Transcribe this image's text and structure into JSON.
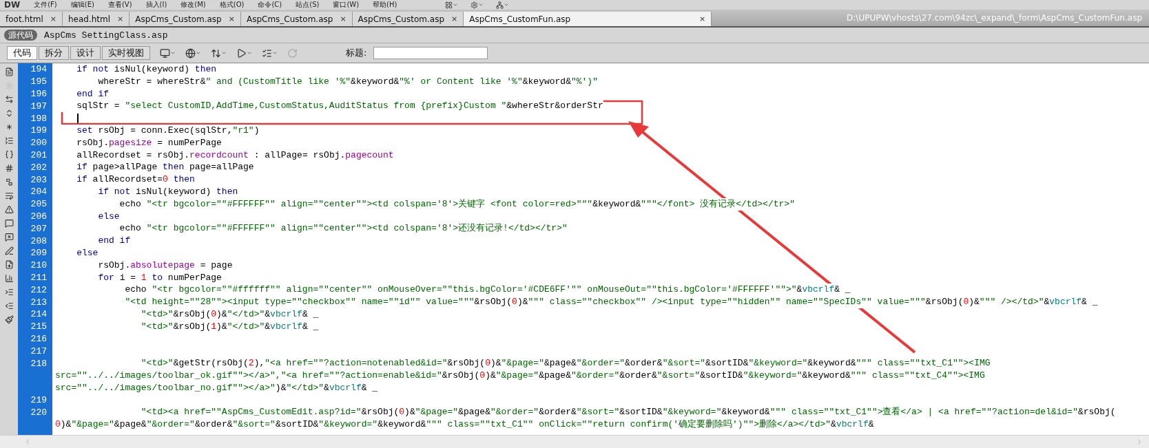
{
  "menu_bar": {
    "logo": "DW",
    "items": [
      "文件(F)",
      "编辑(E)",
      "查看(V)",
      "插入(I)",
      "修改(M)",
      "格式(O)",
      "命令(C)",
      "站点(S)",
      "窗口(W)",
      "帮助(H)"
    ]
  },
  "tabs": [
    {
      "label": "foot.html",
      "close": "×",
      "selected": false
    },
    {
      "label": "head.html",
      "close": "×",
      "selected": false
    },
    {
      "label": "AspCms_Custom.asp",
      "close": "×",
      "selected": false
    },
    {
      "label": "AspCms_Custom.asp",
      "close": "×",
      "selected": false
    },
    {
      "label": "AspCms_Custom.asp",
      "close": "×",
      "selected": false
    },
    {
      "label": "AspCms_CustomFun.asp",
      "close": "×",
      "selected": true
    }
  ],
  "file_path": "D:\\UPUPW\\vhosts\\27.com\\94zc\\_expand\\_form\\AspCms_CustomFun.asp",
  "related_files": {
    "source_label": "源代码",
    "files": [
      "AspCms SettingClass.asp"
    ]
  },
  "view_buttons": [
    {
      "label": "代码",
      "selected": true
    },
    {
      "label": "拆分",
      "selected": false
    },
    {
      "label": "设计",
      "selected": false
    },
    {
      "label": "实时视图",
      "selected": false
    }
  ],
  "title_field": {
    "label": "标题:"
  },
  "code_lines": [
    {
      "number": "194",
      "segments": [
        {
          "kind": "kw",
          "text": "    if not"
        },
        {
          "kind": "plain",
          "text": " isNul(keyword) "
        },
        {
          "kind": "kw",
          "text": "then"
        }
      ]
    },
    {
      "number": "195",
      "segments": [
        {
          "kind": "plain",
          "text": "        whereStr = whereStr&"
        },
        {
          "kind": "str",
          "text": "\" and (CustomTitle like '%\""
        },
        {
          "kind": "plain",
          "text": "&keyword&"
        },
        {
          "kind": "str",
          "text": "\"%' or Content like '%\""
        },
        {
          "kind": "plain",
          "text": "&keyword&"
        },
        {
          "kind": "str",
          "text": "\"%')\""
        }
      ]
    },
    {
      "number": "196",
      "segments": [
        {
          "kind": "kw",
          "text": "    end if"
        }
      ]
    },
    {
      "number": "197",
      "segments": [
        {
          "kind": "plain",
          "text": "    sqlStr = "
        },
        {
          "kind": "str",
          "text": "\"select CustomID,AddTime,CustomStatus,AuditStatus from {prefix}Custom \""
        },
        {
          "kind": "plain",
          "text": "&whereStr&orderStr"
        }
      ]
    },
    {
      "number": "198",
      "cursor": true
    },
    {
      "number": "199",
      "segments": [
        {
          "kind": "kw",
          "text": "    set"
        },
        {
          "kind": "plain",
          "text": " rsObj = conn.Exec(sqlStr,"
        },
        {
          "kind": "str",
          "text": "\"r1\""
        },
        {
          "kind": "plain",
          "text": ")"
        }
      ]
    },
    {
      "number": "200",
      "segments": [
        {
          "kind": "plain",
          "text": "    rsObj."
        },
        {
          "kind": "prop",
          "text": "pagesize"
        },
        {
          "kind": "plain",
          "text": " = numPerPage"
        }
      ]
    },
    {
      "number": "201",
      "segments": [
        {
          "kind": "plain",
          "text": "    allRecordset = rsObj."
        },
        {
          "kind": "prop",
          "text": "recordcount"
        },
        {
          "kind": "plain",
          "text": " : allPage= rsObj."
        },
        {
          "kind": "prop",
          "text": "pagecount"
        }
      ]
    },
    {
      "number": "202",
      "segments": [
        {
          "kind": "kw",
          "text": "    if"
        },
        {
          "kind": "plain",
          "text": " page>allPage "
        },
        {
          "kind": "kw",
          "text": "then"
        },
        {
          "kind": "plain",
          "text": " page=allPage"
        }
      ]
    },
    {
      "number": "203",
      "segments": [
        {
          "kind": "kw",
          "text": "    if"
        },
        {
          "kind": "plain",
          "text": " allRecordset="
        },
        {
          "kind": "num",
          "text": "0"
        },
        {
          "kind": "kw",
          "text": " then"
        }
      ]
    },
    {
      "number": "204",
      "segments": [
        {
          "kind": "kw",
          "text": "        if not"
        },
        {
          "kind": "plain",
          "text": " isNul(keyword) "
        },
        {
          "kind": "kw",
          "text": "then"
        }
      ]
    },
    {
      "number": "205",
      "segments": [
        {
          "kind": "plain",
          "text": "            echo "
        },
        {
          "kind": "str",
          "text": "\"<tr bgcolor=\"\"#FFFFFF\"\" align=\"\"center\"\"><td colspan='8'>关键字 <font color=red>\"\"\""
        },
        {
          "kind": "plain",
          "text": "&keyword&"
        },
        {
          "kind": "str",
          "text": "\"\"\"</font> 没有记录</td></tr>\""
        }
      ]
    },
    {
      "number": "206",
      "segments": [
        {
          "kind": "kw",
          "text": "        else"
        }
      ]
    },
    {
      "number": "207",
      "segments": [
        {
          "kind": "plain",
          "text": "            echo "
        },
        {
          "kind": "str",
          "text": "\"<tr bgcolor=\"\"#FFFFFF\"\" align=\"\"center\"\"><td colspan='8'>还没有记录!</td></tr>\""
        }
      ]
    },
    {
      "number": "208",
      "segments": [
        {
          "kind": "kw",
          "text": "        end if"
        }
      ]
    },
    {
      "number": "209",
      "segments": [
        {
          "kind": "kw",
          "text": "    else"
        }
      ]
    },
    {
      "number": "210",
      "segments": [
        {
          "kind": "plain",
          "text": "        rsObj."
        },
        {
          "kind": "prop",
          "text": "absolutepage"
        },
        {
          "kind": "plain",
          "text": " = page"
        }
      ]
    },
    {
      "number": "211",
      "segments": [
        {
          "kind": "kw",
          "text": "        for"
        },
        {
          "kind": "plain",
          "text": " i = "
        },
        {
          "kind": "num",
          "text": "1"
        },
        {
          "kind": "kw",
          "text": " to"
        },
        {
          "kind": "plain",
          "text": " numPerPage"
        }
      ]
    },
    {
      "number": "212",
      "segments": [
        {
          "kind": "plain",
          "text": "             echo "
        },
        {
          "kind": "str",
          "text": "\"<tr bgcolor=\"\"#ffffff\"\" align=\"\"center\"\" onMouseOver=\"\"this.bgColor='#CDE6FF'\"\" onMouseOut=\"\"this.bgColor='#FFFFFF'\"\">\""
        },
        {
          "kind": "plain",
          "text": "&"
        },
        {
          "kind": "const",
          "text": "vbcrlf"
        },
        {
          "kind": "plain",
          "text": "& _"
        }
      ]
    },
    {
      "number": "213",
      "segments": [
        {
          "kind": "str",
          "text": "             \"<td height=\"\"28\"\"><input type=\"\"checkbox\"\" name=\"\"id\"\" value=\"\"\""
        },
        {
          "kind": "plain",
          "text": "&rsObj("
        },
        {
          "kind": "num",
          "text": "0"
        },
        {
          "kind": "plain",
          "text": ")&"
        },
        {
          "kind": "str",
          "text": "\"\"\" class=\"\"checkbox\"\" /><input type=\"\"hidden\"\" name=\"\"SpecIDs\"\" value=\"\"\""
        },
        {
          "kind": "plain",
          "text": "&rsObj("
        },
        {
          "kind": "num",
          "text": "0"
        },
        {
          "kind": "plain",
          "text": ")&"
        },
        {
          "kind": "str",
          "text": "\"\"\" /></td>\""
        },
        {
          "kind": "plain",
          "text": "&"
        },
        {
          "kind": "const",
          "text": "vbcrlf"
        },
        {
          "kind": "plain",
          "text": "& _"
        }
      ]
    },
    {
      "number": "214",
      "segments": [
        {
          "kind": "str",
          "text": "                \"<td>\""
        },
        {
          "kind": "plain",
          "text": "&rsObj("
        },
        {
          "kind": "num",
          "text": "0"
        },
        {
          "kind": "plain",
          "text": ")&"
        },
        {
          "kind": "str",
          "text": "\"</td>\""
        },
        {
          "kind": "plain",
          "text": "&"
        },
        {
          "kind": "const",
          "text": "vbcrlf"
        },
        {
          "kind": "plain",
          "text": "& _"
        }
      ]
    },
    {
      "number": "215",
      "segments": [
        {
          "kind": "str",
          "text": "                \"<td>\""
        },
        {
          "kind": "plain",
          "text": "&rsObj("
        },
        {
          "kind": "num",
          "text": "1"
        },
        {
          "kind": "plain",
          "text": ")&"
        },
        {
          "kind": "str",
          "text": "\"</td>\""
        },
        {
          "kind": "plain",
          "text": "&"
        },
        {
          "kind": "const",
          "text": "vbcrlf"
        },
        {
          "kind": "plain",
          "text": "& _"
        }
      ]
    },
    {
      "number": "216"
    },
    {
      "number": "217"
    },
    {
      "number": "218",
      "segments": [
        {
          "kind": "str",
          "text": "                \"<td>\""
        },
        {
          "kind": "plain",
          "text": "&getStr(rsObj("
        },
        {
          "kind": "num",
          "text": "2"
        },
        {
          "kind": "plain",
          "text": "),"
        },
        {
          "kind": "str",
          "text": "\"<a href=\"\"?action=notenabled&id=\""
        },
        {
          "kind": "plain",
          "text": "&rsObj("
        },
        {
          "kind": "num",
          "text": "0"
        },
        {
          "kind": "plain",
          "text": ")&"
        },
        {
          "kind": "str",
          "text": "\"&page=\""
        },
        {
          "kind": "plain",
          "text": "&page&"
        },
        {
          "kind": "str",
          "text": "\"&order=\""
        },
        {
          "kind": "plain",
          "text": "&order&"
        },
        {
          "kind": "str",
          "text": "\"&sort=\""
        },
        {
          "kind": "plain",
          "text": "&sortID&"
        },
        {
          "kind": "str",
          "text": "\"&keyword=\""
        },
        {
          "kind": "plain",
          "text": "&keyword&"
        },
        {
          "kind": "str",
          "text": "\"\"\" class=\"\"txt_C1\"\"><IMG"
        }
      ],
      "continuation": [
        [
          {
            "kind": "str",
            "text": "src=\"\"../../images/toolbar_ok.gif\"\"></a>\",\"<a href=\"\"?action=enable&id=\""
          },
          {
            "kind": "plain",
            "text": "&rsObj("
          },
          {
            "kind": "num",
            "text": "0"
          },
          {
            "kind": "plain",
            "text": ")&"
          },
          {
            "kind": "str",
            "text": "\"&page=\""
          },
          {
            "kind": "plain",
            "text": "&page&"
          },
          {
            "kind": "str",
            "text": "\"&order=\""
          },
          {
            "kind": "plain",
            "text": "&order&"
          },
          {
            "kind": "str",
            "text": "\"&sort=\""
          },
          {
            "kind": "plain",
            "text": "&sortID&"
          },
          {
            "kind": "str",
            "text": "\"&keyword=\""
          },
          {
            "kind": "plain",
            "text": "&keyword&"
          },
          {
            "kind": "str",
            "text": "\"\"\" class=\"\"txt_C4\"\"><IMG"
          }
        ],
        [
          {
            "kind": "str",
            "text": "src=\"\"../../images/toolbar_no.gif\"\"></a>\""
          },
          {
            "kind": "plain",
            "text": ")&"
          },
          {
            "kind": "str",
            "text": "\"</td>\""
          },
          {
            "kind": "plain",
            "text": "&"
          },
          {
            "kind": "const",
            "text": "vbcrlf"
          },
          {
            "kind": "plain",
            "text": "& _"
          }
        ]
      ]
    },
    {
      "number": "219"
    },
    {
      "number": "220",
      "segments": [
        {
          "kind": "str",
          "text": "                \"<td><a href=\"\"AspCms_CustomEdit.asp?id=\""
        },
        {
          "kind": "plain",
          "text": "&rsObj("
        },
        {
          "kind": "num",
          "text": "0"
        },
        {
          "kind": "plain",
          "text": ")&"
        },
        {
          "kind": "str",
          "text": "\"&page=\""
        },
        {
          "kind": "plain",
          "text": "&page&"
        },
        {
          "kind": "str",
          "text": "\"&order=\""
        },
        {
          "kind": "plain",
          "text": "&order&"
        },
        {
          "kind": "str",
          "text": "\"&sort=\""
        },
        {
          "kind": "plain",
          "text": "&sortID&"
        },
        {
          "kind": "str",
          "text": "\"&keyword=\""
        },
        {
          "kind": "plain",
          "text": "&keyword&"
        },
        {
          "kind": "str",
          "text": "\"\"\" class=\"\"txt_C1\"\">查看</a> | <a href=\"\"?action=del&id=\""
        },
        {
          "kind": "plain",
          "text": "&rsObj("
        }
      ],
      "continuation": [
        [
          {
            "kind": "num",
            "text": "0"
          },
          {
            "kind": "plain",
            "text": ")&"
          },
          {
            "kind": "str",
            "text": "\"&page=\""
          },
          {
            "kind": "plain",
            "text": "&page&"
          },
          {
            "kind": "str",
            "text": "\"&order=\""
          },
          {
            "kind": "plain",
            "text": "&order&"
          },
          {
            "kind": "str",
            "text": "\"&sort=\""
          },
          {
            "kind": "plain",
            "text": "&sortID&"
          },
          {
            "kind": "str",
            "text": "\"&keyword=\""
          },
          {
            "kind": "plain",
            "text": "&keyword&"
          },
          {
            "kind": "str",
            "text": "\"\"\" class=\"\"txt_C1\"\" onClick=\"\"return confirm('确定要删除吗')\"\">删除</a></td>\""
          },
          {
            "kind": "plain",
            "text": "&"
          },
          {
            "kind": "const",
            "text": "vbcrlf"
          },
          {
            "kind": "plain",
            "text": "&"
          }
        ]
      ]
    }
  ]
}
